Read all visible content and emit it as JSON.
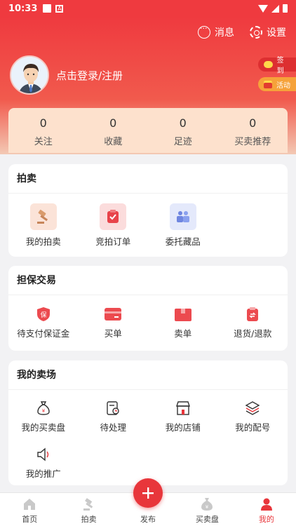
{
  "status_bar": {
    "time": "10:33"
  },
  "header": {
    "messages_label": "消息",
    "settings_label": "设置",
    "login_prompt": "点击登录/注册",
    "signin_pill": "签到",
    "activity_pill": "活动"
  },
  "stats": [
    {
      "value": "0",
      "label": "关注"
    },
    {
      "value": "0",
      "label": "收藏"
    },
    {
      "value": "0",
      "label": "足迹"
    },
    {
      "value": "0",
      "label": "买卖推荐"
    }
  ],
  "auction": {
    "title": "拍卖",
    "items": [
      {
        "label": "我的拍卖",
        "icon": "gavel-icon"
      },
      {
        "label": "竞拍订单",
        "icon": "clipboard-icon"
      },
      {
        "label": "委托藏品",
        "icon": "handshake-icon"
      }
    ]
  },
  "escrow": {
    "title": "担保交易",
    "items": [
      {
        "label": "待支付保证金",
        "icon": "shield-icon"
      },
      {
        "label": "买单",
        "icon": "card-icon"
      },
      {
        "label": "卖单",
        "icon": "box-icon"
      },
      {
        "label": "退货/退款",
        "icon": "refund-icon"
      }
    ]
  },
  "market": {
    "title": "我的卖场",
    "items": [
      {
        "label": "我的买卖盘",
        "icon": "money-bag-icon"
      },
      {
        "label": "待处理",
        "icon": "pending-icon"
      },
      {
        "label": "我的店铺",
        "icon": "store-icon"
      },
      {
        "label": "我的配号",
        "icon": "layers-icon"
      },
      {
        "label": "我的推广",
        "icon": "megaphone-icon"
      }
    ]
  },
  "tabbar": {
    "tabs": [
      {
        "label": "首页",
        "icon": "home-icon"
      },
      {
        "label": "拍卖",
        "icon": "gavel-icon"
      },
      {
        "label": "发布",
        "icon": "plus-icon"
      },
      {
        "label": "买卖盘",
        "icon": "money-bag-icon"
      },
      {
        "label": "我的",
        "icon": "user-icon"
      }
    ],
    "active": "我的"
  },
  "colors": {
    "accent": "#e8363b",
    "header": "#ef3a3f",
    "stats_bg": "#fde1cd"
  }
}
